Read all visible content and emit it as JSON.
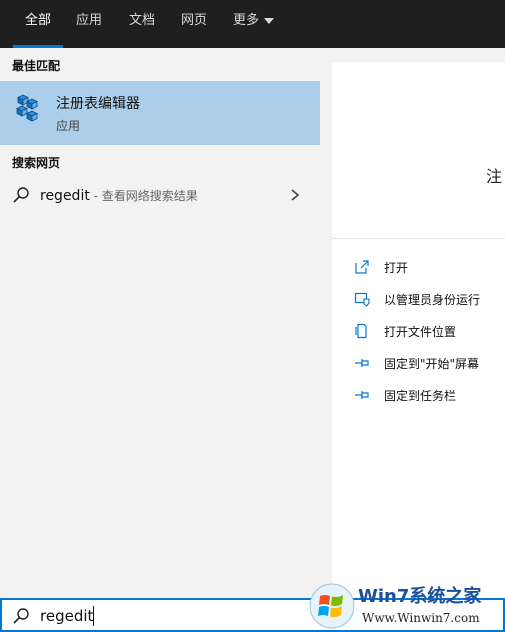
{
  "tabs": [
    {
      "label": "全部",
      "active": true
    },
    {
      "label": "应用",
      "active": false
    },
    {
      "label": "文档",
      "active": false
    },
    {
      "label": "网页",
      "active": false
    },
    {
      "label": "更多",
      "active": false
    }
  ],
  "best_match": {
    "header": "最佳匹配",
    "title": "注册表编辑器",
    "subtitle": "应用",
    "icon": "registry-editor-icon"
  },
  "web_search": {
    "header": "搜索网页",
    "query": "regedit",
    "desc": " - 查看网络搜索结果"
  },
  "detail": {
    "title": "注",
    "actions": [
      {
        "label": "打开",
        "icon": "open-icon"
      },
      {
        "label": "以管理员身份运行",
        "icon": "run-as-admin-icon"
      },
      {
        "label": "打开文件位置",
        "icon": "file-location-icon"
      },
      {
        "label": "固定到\"开始\"屏幕",
        "icon": "pin-icon"
      },
      {
        "label": "固定到任务栏",
        "icon": "pin-icon"
      }
    ]
  },
  "search": {
    "value": "regedit"
  },
  "watermark": {
    "text": "Win7系统之家",
    "url": "Www.Winwin7.com"
  },
  "colors": {
    "accent": "#0078d7",
    "selected": "#abcfea",
    "topbar": "#1f1f1f"
  }
}
